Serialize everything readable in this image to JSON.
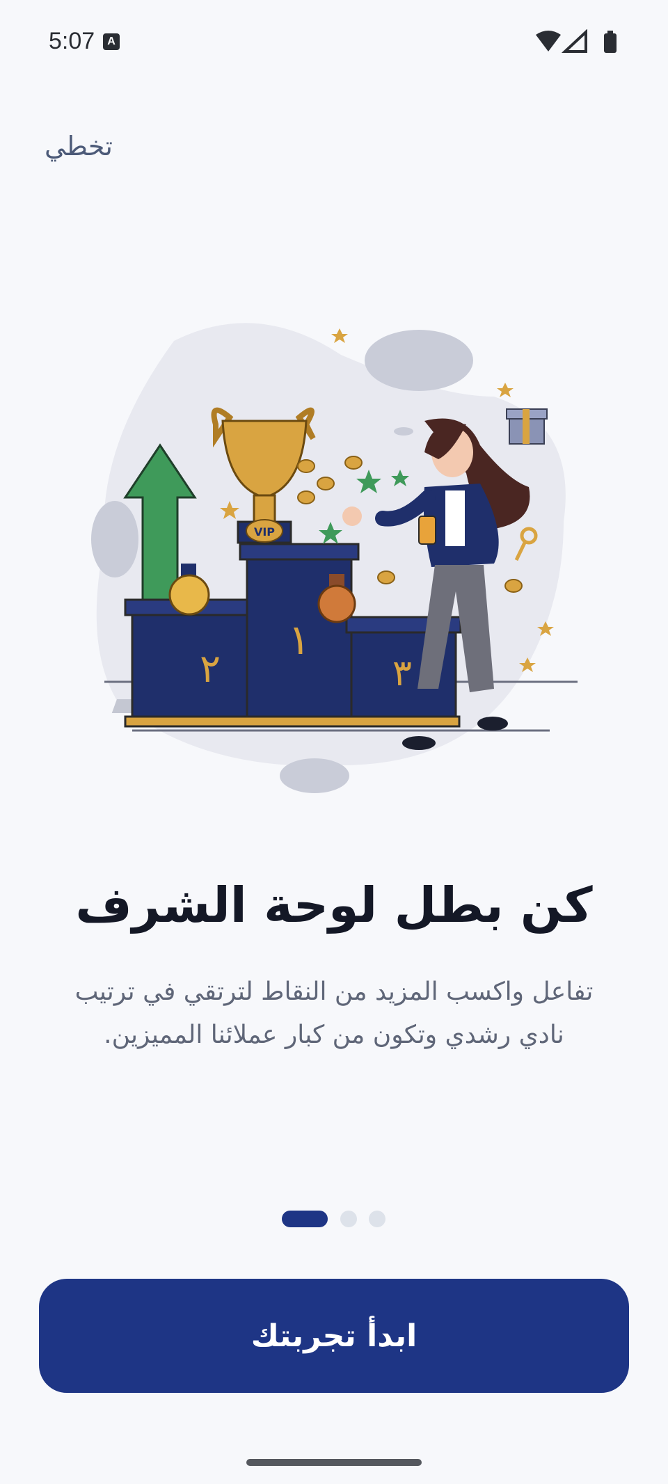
{
  "status_bar": {
    "time": "5:07",
    "notification_icon_letter": "A",
    "icons": [
      "wifi-icon",
      "cellular-signal-icon",
      "battery-icon"
    ]
  },
  "header": {
    "skip_label": "تخطي"
  },
  "onboarding": {
    "title": "كن بطل لوحة الشرف",
    "description": "تفاعل واكسب المزيد من النقاط لترتقي في ترتيب نادي رشدي وتكون من كبار عملائنا المميزين.",
    "illustration": {
      "cup_label": "VIP",
      "podium_labels": [
        "١",
        "٢",
        "٣"
      ]
    },
    "pager": {
      "total_pages": 3,
      "active_page": 1
    }
  },
  "actions": {
    "start_label": "ابدأ تجربتك"
  },
  "colors": {
    "primary": "#1e3585",
    "background": "#f7f8fb",
    "gold": "#d9a441",
    "green": "#3f9a5a"
  }
}
